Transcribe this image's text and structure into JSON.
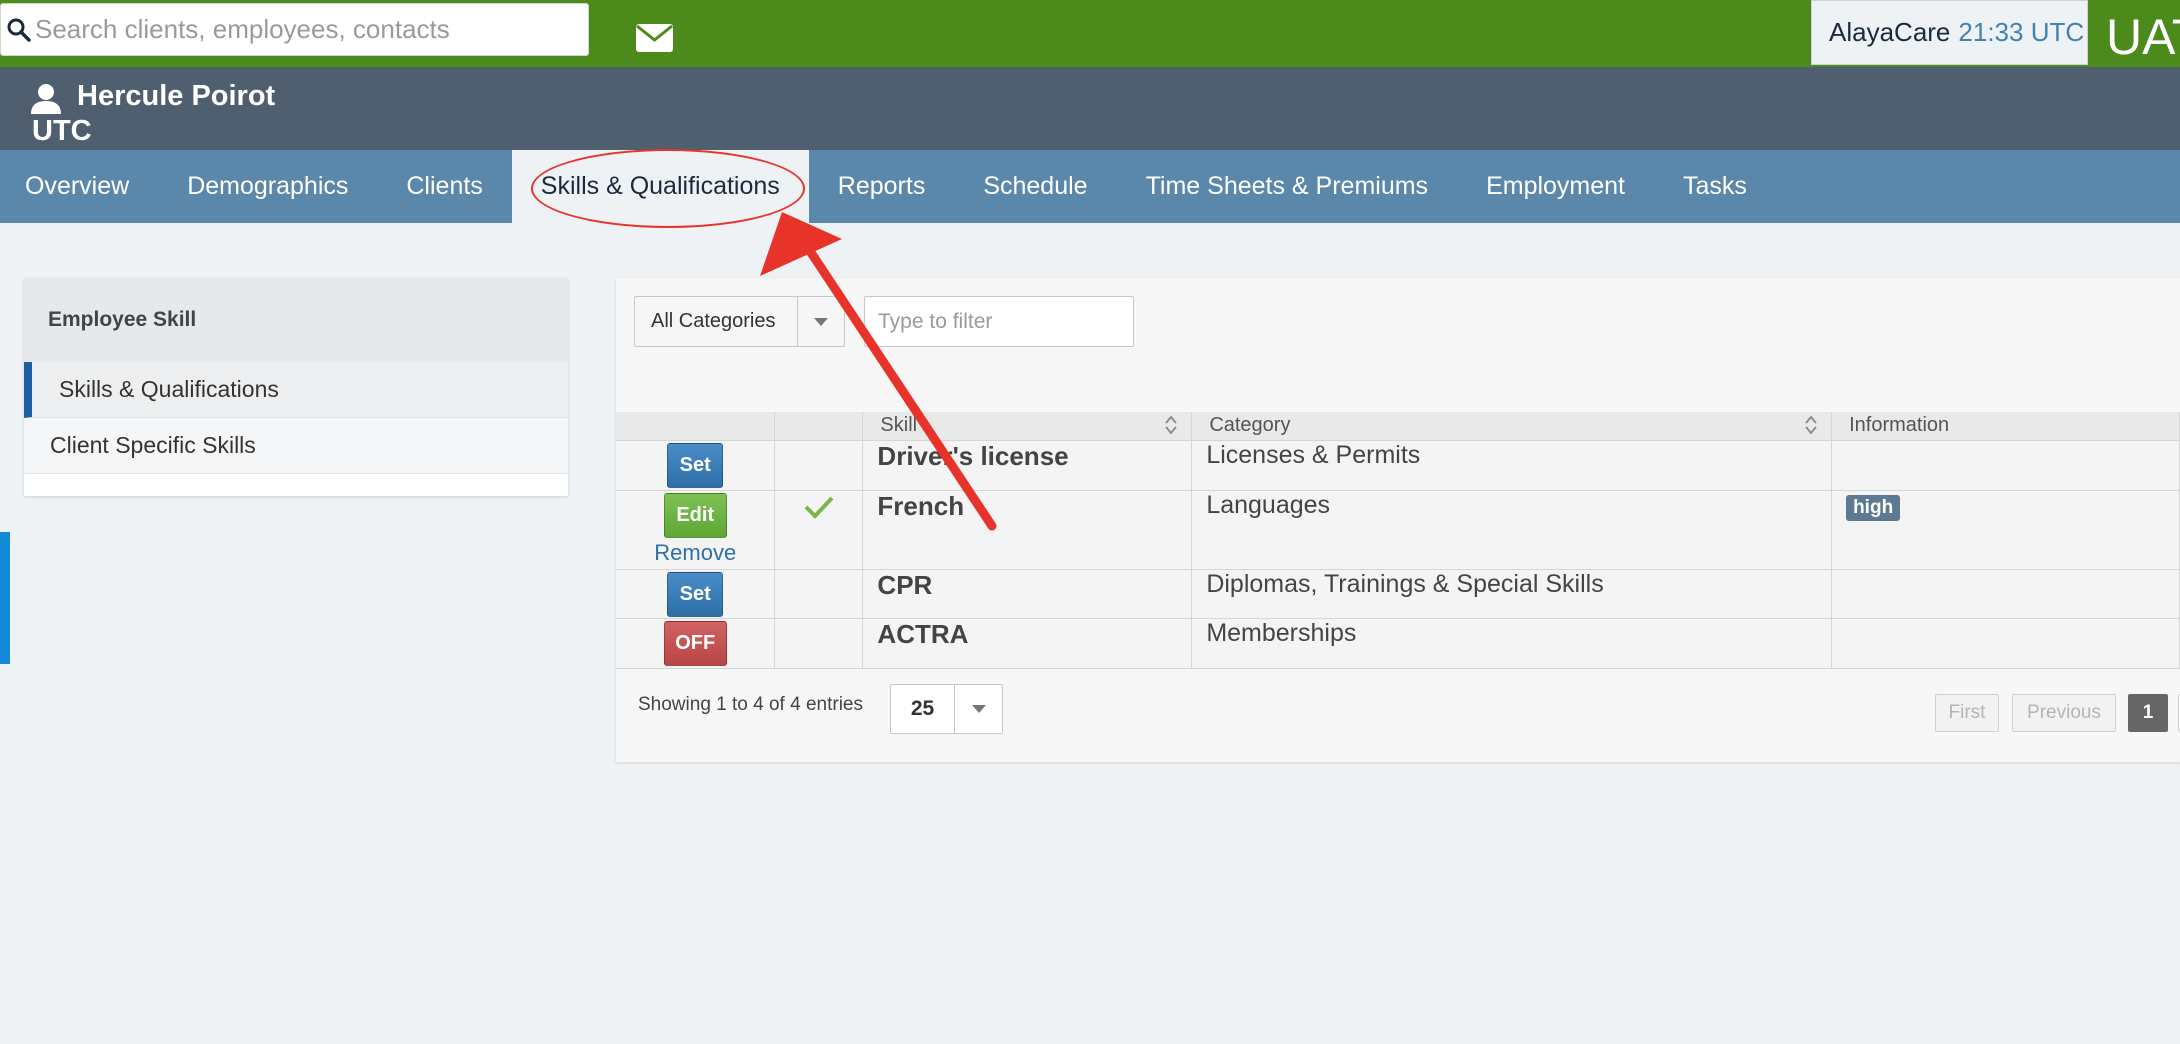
{
  "topbar": {
    "search_placeholder": "Search clients, employees, contacts",
    "mail_icon": "envelope-icon",
    "brand": "AlayaCare",
    "time": "21:33 UTC",
    "env_label": "UAT"
  },
  "header": {
    "name": "Hercule Poirot",
    "timezone": "UTC"
  },
  "tabs": [
    {
      "label": "Overview"
    },
    {
      "label": "Demographics"
    },
    {
      "label": "Clients"
    },
    {
      "label": "Skills & Qualifications",
      "active": true
    },
    {
      "label": "Reports"
    },
    {
      "label": "Schedule"
    },
    {
      "label": "Time Sheets & Premiums"
    },
    {
      "label": "Employment"
    },
    {
      "label": "Tasks"
    }
  ],
  "sidebar": {
    "title": "Employee Skill",
    "items": [
      {
        "label": "Skills & Qualifications",
        "active": true
      },
      {
        "label": "Client Specific Skills"
      }
    ]
  },
  "filters": {
    "category": "All Categories",
    "filter_placeholder": "Type to filter"
  },
  "table": {
    "columns": [
      "",
      "",
      "Skill",
      "Category",
      "Information"
    ],
    "rows": [
      {
        "action": "Set",
        "checked": false,
        "skill": "Driver's license",
        "category": "Licenses & Permits",
        "info": ""
      },
      {
        "action": "Edit",
        "secondary_action": "Remove",
        "checked": true,
        "skill": "French",
        "category": "Languages",
        "info": "high"
      },
      {
        "action": "Set",
        "checked": false,
        "skill": "CPR",
        "category": "Diplomas, Trainings & Special Skills",
        "info": ""
      },
      {
        "action": "OFF",
        "checked": false,
        "skill": "ACTRA",
        "category": "Memberships",
        "info": ""
      }
    ]
  },
  "pagination": {
    "summary": "Showing 1 to 4 of 4 entries",
    "page_size": "25",
    "first": "First",
    "previous": "Previous",
    "current_page": "1"
  },
  "colors": {
    "topbar": "#4b8a1b",
    "header": "#4f5f6f",
    "tabs": "#5b87ab",
    "annotation": "#e8332b"
  }
}
